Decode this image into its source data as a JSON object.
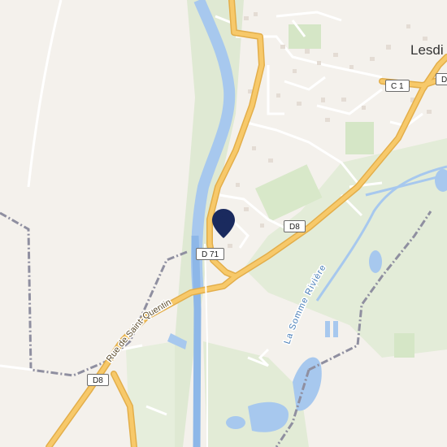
{
  "map": {
    "place_label": "Lesdi",
    "road_shields": {
      "c1": "C 1",
      "d8_right": "D8",
      "d71": "D 71",
      "d8_left": "D8",
      "d8_topright": "D"
    },
    "street_label": "Rue de Saint-Quentin",
    "river_label": "La Somme Rivière",
    "marker": {
      "icon": "location-pin-icon",
      "color": "#1a2a5e"
    },
    "colors": {
      "background": "#f4f1ec",
      "water": "#a7c8ee",
      "canal": "#8db7e8",
      "road_major": "#f7c96a",
      "road_outline": "#e3ae4a",
      "road_minor": "#ffffff",
      "greenery": "#dfe9d3",
      "boundary": "#8f8fa0"
    }
  }
}
